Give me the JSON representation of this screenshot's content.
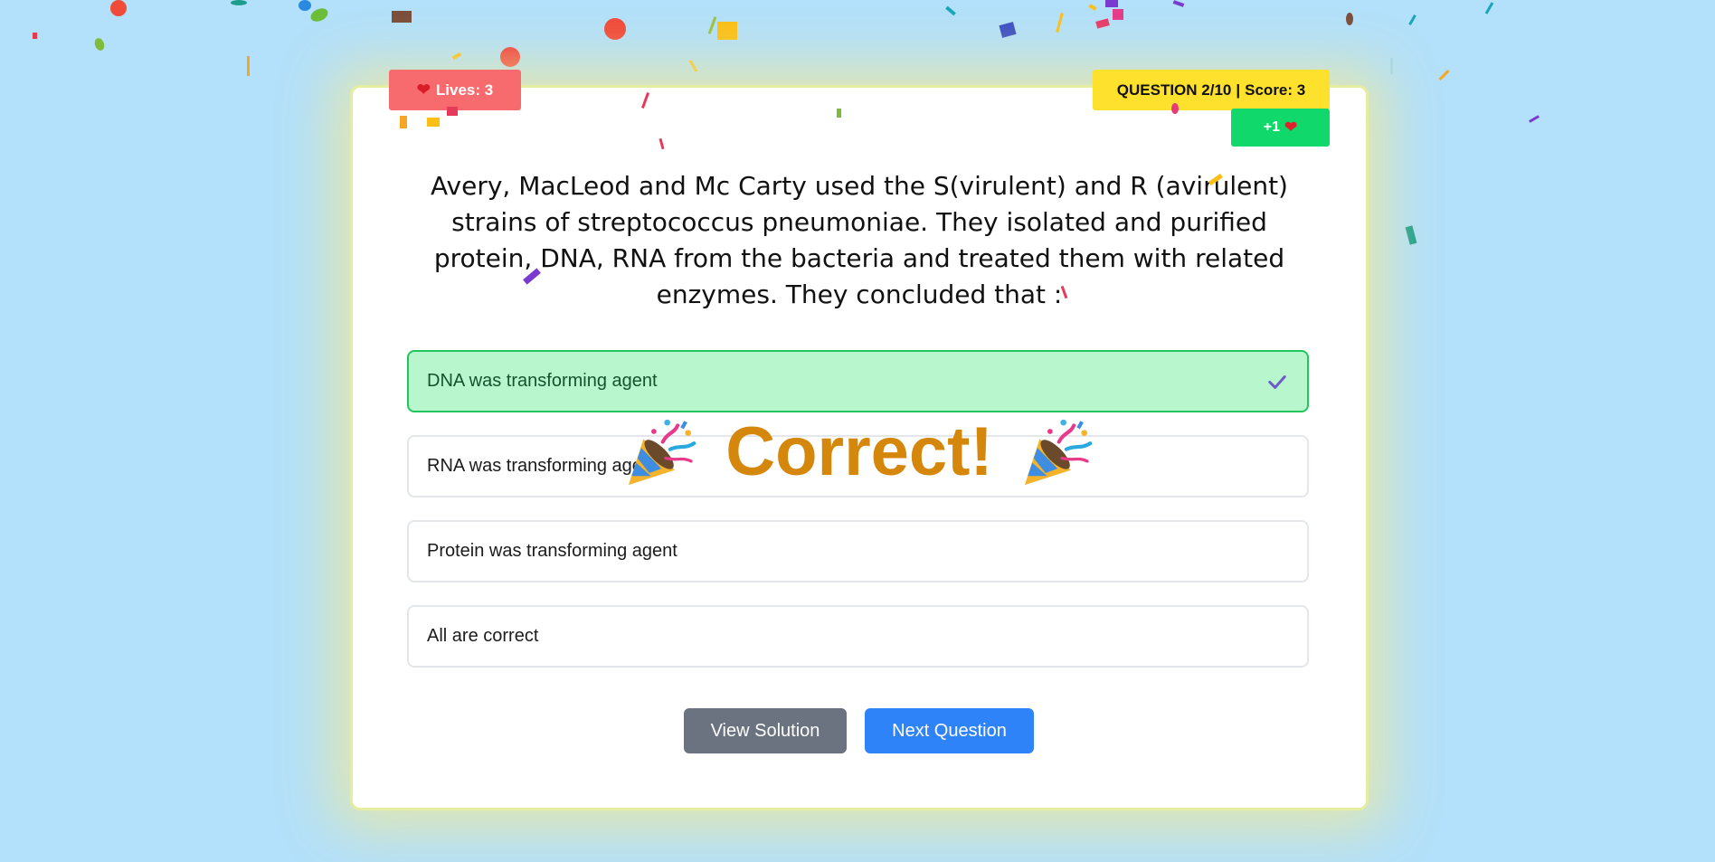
{
  "status": {
    "lives_label": "Lives: 3",
    "question_progress": "QUESTION 2/10",
    "separator": "|",
    "score_label": "Score: 3",
    "bonus_label": "+1"
  },
  "question": {
    "text": "Avery, MacLeod and Mc Carty used the S(virulent) and R (avirulent) strains of streptococcus pneumoniae. They isolated and purified protein, DNA, RNA from the bacteria and treated them with related enzymes. They concluded that :"
  },
  "options": [
    {
      "label": "DNA was transforming agent",
      "state": "correct-selected"
    },
    {
      "label": "RNA was transforming agent",
      "state": "default"
    },
    {
      "label": "Protein was transforming agent",
      "state": "default"
    },
    {
      "label": "All are correct",
      "state": "default"
    }
  ],
  "feedback": {
    "message": "Correct!"
  },
  "actions": {
    "view_solution_label": "View Solution",
    "next_question_label": "Next Question"
  },
  "icons": {
    "lives": "heart-icon",
    "bonus": "heart-icon",
    "correct_option": "check-icon",
    "celebration": "party-popper-icon"
  },
  "colors": {
    "background": "#b3e0fa",
    "lives_badge": "#f76b6f",
    "question_badge": "#fde12d",
    "bonus_badge": "#11d86b",
    "correct_option_bg": "#b8f6cd",
    "correct_option_border": "#22c55e",
    "correct_text": "#d4870b",
    "view_solution_button": "#6b7280",
    "next_question_button": "#2f83f8"
  }
}
